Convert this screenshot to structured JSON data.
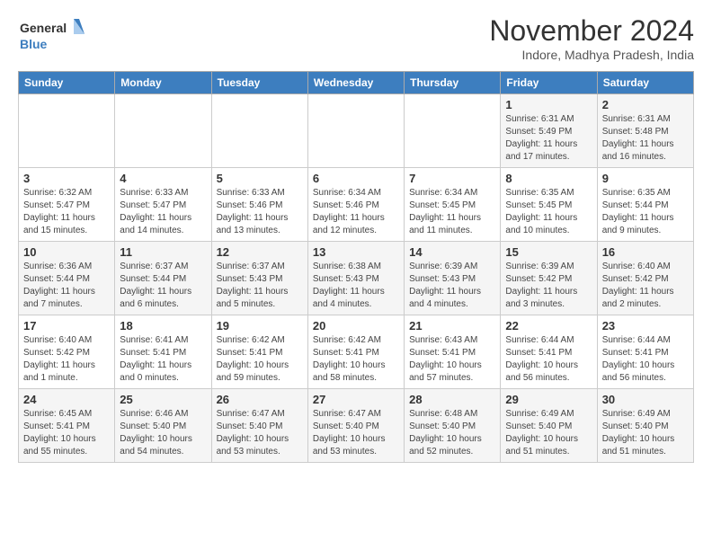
{
  "header": {
    "logo_line1": "General",
    "logo_line2": "Blue",
    "month_title": "November 2024",
    "location": "Indore, Madhya Pradesh, India"
  },
  "weekdays": [
    "Sunday",
    "Monday",
    "Tuesday",
    "Wednesday",
    "Thursday",
    "Friday",
    "Saturday"
  ],
  "weeks": [
    [
      {
        "day": "",
        "info": ""
      },
      {
        "day": "",
        "info": ""
      },
      {
        "day": "",
        "info": ""
      },
      {
        "day": "",
        "info": ""
      },
      {
        "day": "",
        "info": ""
      },
      {
        "day": "1",
        "info": "Sunrise: 6:31 AM\nSunset: 5:49 PM\nDaylight: 11 hours and 17 minutes."
      },
      {
        "day": "2",
        "info": "Sunrise: 6:31 AM\nSunset: 5:48 PM\nDaylight: 11 hours and 16 minutes."
      }
    ],
    [
      {
        "day": "3",
        "info": "Sunrise: 6:32 AM\nSunset: 5:47 PM\nDaylight: 11 hours and 15 minutes."
      },
      {
        "day": "4",
        "info": "Sunrise: 6:33 AM\nSunset: 5:47 PM\nDaylight: 11 hours and 14 minutes."
      },
      {
        "day": "5",
        "info": "Sunrise: 6:33 AM\nSunset: 5:46 PM\nDaylight: 11 hours and 13 minutes."
      },
      {
        "day": "6",
        "info": "Sunrise: 6:34 AM\nSunset: 5:46 PM\nDaylight: 11 hours and 12 minutes."
      },
      {
        "day": "7",
        "info": "Sunrise: 6:34 AM\nSunset: 5:45 PM\nDaylight: 11 hours and 11 minutes."
      },
      {
        "day": "8",
        "info": "Sunrise: 6:35 AM\nSunset: 5:45 PM\nDaylight: 11 hours and 10 minutes."
      },
      {
        "day": "9",
        "info": "Sunrise: 6:35 AM\nSunset: 5:44 PM\nDaylight: 11 hours and 9 minutes."
      }
    ],
    [
      {
        "day": "10",
        "info": "Sunrise: 6:36 AM\nSunset: 5:44 PM\nDaylight: 11 hours and 7 minutes."
      },
      {
        "day": "11",
        "info": "Sunrise: 6:37 AM\nSunset: 5:44 PM\nDaylight: 11 hours and 6 minutes."
      },
      {
        "day": "12",
        "info": "Sunrise: 6:37 AM\nSunset: 5:43 PM\nDaylight: 11 hours and 5 minutes."
      },
      {
        "day": "13",
        "info": "Sunrise: 6:38 AM\nSunset: 5:43 PM\nDaylight: 11 hours and 4 minutes."
      },
      {
        "day": "14",
        "info": "Sunrise: 6:39 AM\nSunset: 5:43 PM\nDaylight: 11 hours and 4 minutes."
      },
      {
        "day": "15",
        "info": "Sunrise: 6:39 AM\nSunset: 5:42 PM\nDaylight: 11 hours and 3 minutes."
      },
      {
        "day": "16",
        "info": "Sunrise: 6:40 AM\nSunset: 5:42 PM\nDaylight: 11 hours and 2 minutes."
      }
    ],
    [
      {
        "day": "17",
        "info": "Sunrise: 6:40 AM\nSunset: 5:42 PM\nDaylight: 11 hours and 1 minute."
      },
      {
        "day": "18",
        "info": "Sunrise: 6:41 AM\nSunset: 5:41 PM\nDaylight: 11 hours and 0 minutes."
      },
      {
        "day": "19",
        "info": "Sunrise: 6:42 AM\nSunset: 5:41 PM\nDaylight: 10 hours and 59 minutes."
      },
      {
        "day": "20",
        "info": "Sunrise: 6:42 AM\nSunset: 5:41 PM\nDaylight: 10 hours and 58 minutes."
      },
      {
        "day": "21",
        "info": "Sunrise: 6:43 AM\nSunset: 5:41 PM\nDaylight: 10 hours and 57 minutes."
      },
      {
        "day": "22",
        "info": "Sunrise: 6:44 AM\nSunset: 5:41 PM\nDaylight: 10 hours and 56 minutes."
      },
      {
        "day": "23",
        "info": "Sunrise: 6:44 AM\nSunset: 5:41 PM\nDaylight: 10 hours and 56 minutes."
      }
    ],
    [
      {
        "day": "24",
        "info": "Sunrise: 6:45 AM\nSunset: 5:41 PM\nDaylight: 10 hours and 55 minutes."
      },
      {
        "day": "25",
        "info": "Sunrise: 6:46 AM\nSunset: 5:40 PM\nDaylight: 10 hours and 54 minutes."
      },
      {
        "day": "26",
        "info": "Sunrise: 6:47 AM\nSunset: 5:40 PM\nDaylight: 10 hours and 53 minutes."
      },
      {
        "day": "27",
        "info": "Sunrise: 6:47 AM\nSunset: 5:40 PM\nDaylight: 10 hours and 53 minutes."
      },
      {
        "day": "28",
        "info": "Sunrise: 6:48 AM\nSunset: 5:40 PM\nDaylight: 10 hours and 52 minutes."
      },
      {
        "day": "29",
        "info": "Sunrise: 6:49 AM\nSunset: 5:40 PM\nDaylight: 10 hours and 51 minutes."
      },
      {
        "day": "30",
        "info": "Sunrise: 6:49 AM\nSunset: 5:40 PM\nDaylight: 10 hours and 51 minutes."
      }
    ]
  ]
}
